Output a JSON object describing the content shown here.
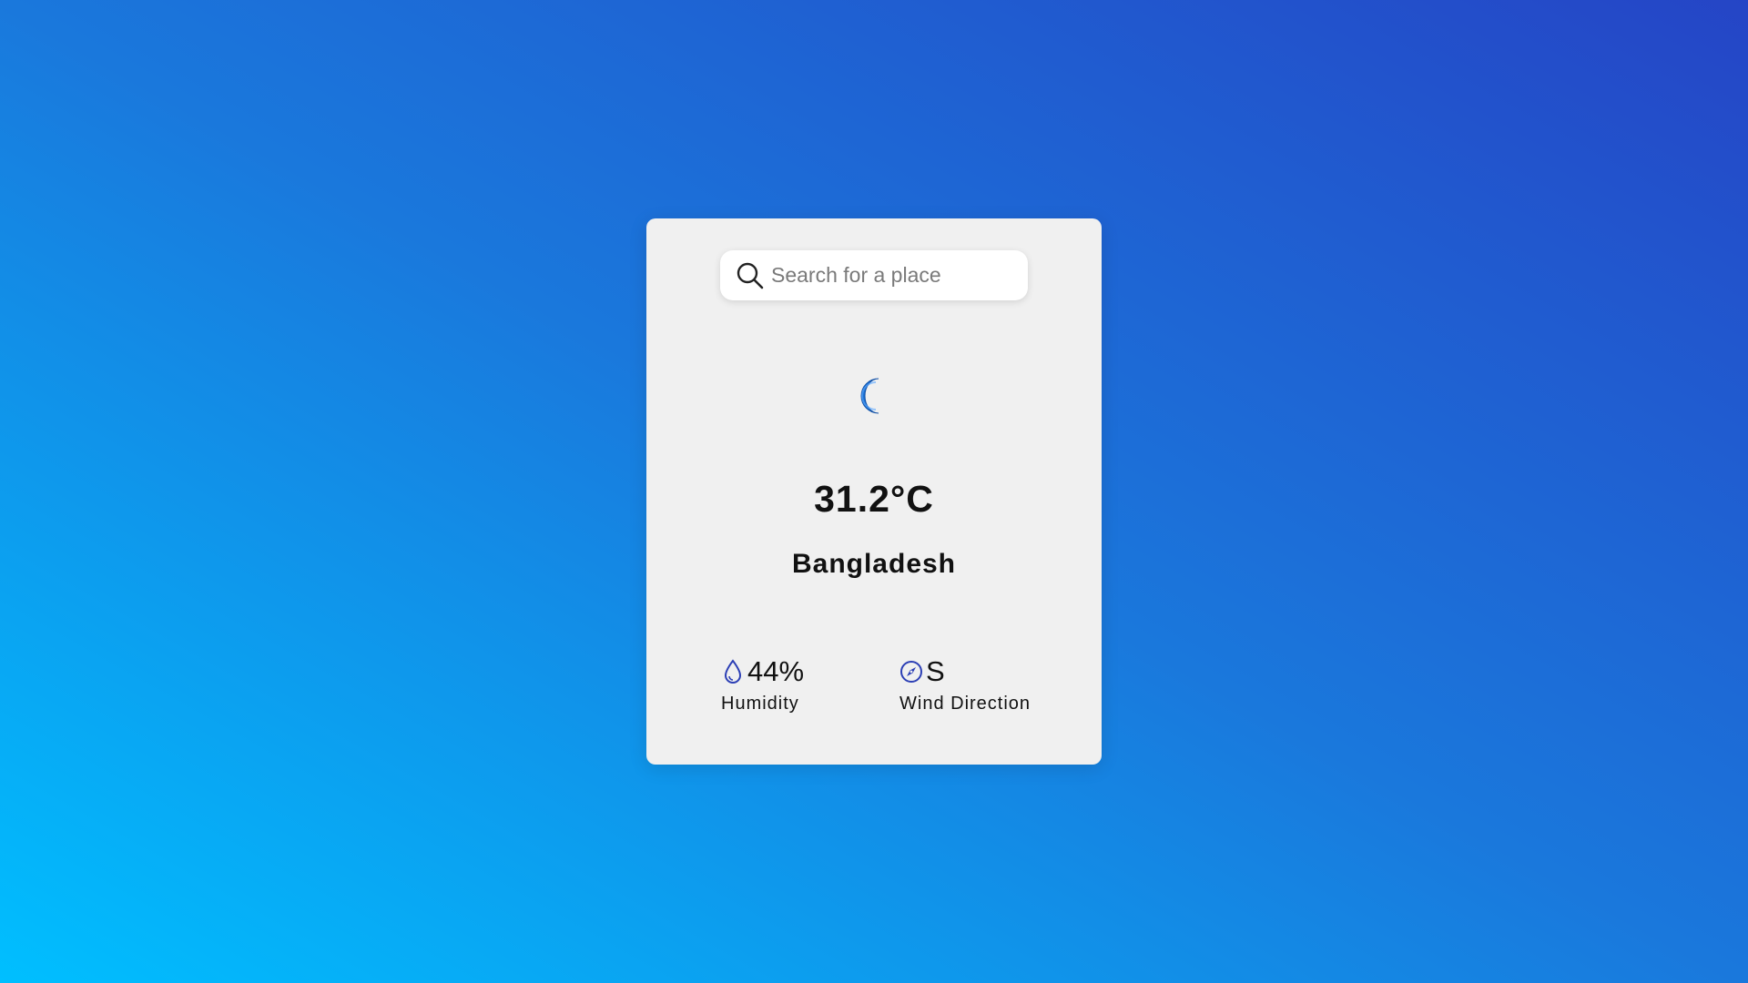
{
  "search": {
    "placeholder": "Search for a place",
    "value": ""
  },
  "weather": {
    "icon": "moon-icon",
    "temperature": "31.2°C",
    "location": "Bangladesh"
  },
  "stats": {
    "humidity": {
      "icon": "water-drop-icon",
      "value": "44%",
      "label": "Humidity"
    },
    "wind": {
      "icon": "compass-icon",
      "value": "S",
      "label": "Wind Direction"
    }
  },
  "colors": {
    "background_gradient": [
      "#00bfff",
      "#1a78dc",
      "#2545c6"
    ],
    "card": "#f0f0f0",
    "icon_accent": "#1a6fd0",
    "stat_icon": "#2c3fb5"
  }
}
